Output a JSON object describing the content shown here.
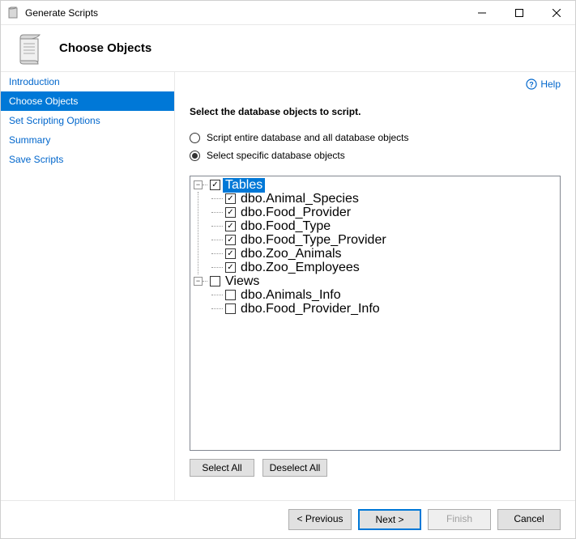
{
  "window": {
    "title": "Generate Scripts"
  },
  "header": {
    "title": "Choose Objects"
  },
  "help": {
    "label": "Help"
  },
  "sidebar": {
    "items": [
      {
        "label": "Introduction",
        "active": false
      },
      {
        "label": "Choose Objects",
        "active": true
      },
      {
        "label": "Set Scripting Options",
        "active": false
      },
      {
        "label": "Summary",
        "active": false
      },
      {
        "label": "Save Scripts",
        "active": false
      }
    ]
  },
  "content": {
    "heading": "Select the database objects to script.",
    "radio": {
      "option_all": "Script entire database and all database objects",
      "option_specific": "Select specific database objects",
      "selected": "specific"
    },
    "tree": [
      {
        "label": "Tables",
        "checked": true,
        "expanded": true,
        "selected": true,
        "children": [
          {
            "label": "dbo.Animal_Species",
            "checked": true
          },
          {
            "label": "dbo.Food_Provider",
            "checked": true
          },
          {
            "label": "dbo.Food_Type",
            "checked": true
          },
          {
            "label": "dbo.Food_Type_Provider",
            "checked": true
          },
          {
            "label": "dbo.Zoo_Animals",
            "checked": true
          },
          {
            "label": "dbo.Zoo_Employees",
            "checked": true
          }
        ]
      },
      {
        "label": "Views",
        "checked": false,
        "expanded": true,
        "selected": false,
        "children": [
          {
            "label": "dbo.Animals_Info",
            "checked": false
          },
          {
            "label": "dbo.Food_Provider_Info",
            "checked": false
          }
        ]
      }
    ],
    "buttons": {
      "select_all": "Select All",
      "deselect_all": "Deselect All"
    }
  },
  "footer": {
    "previous": "< Previous",
    "next": "Next >",
    "finish": "Finish",
    "cancel": "Cancel"
  }
}
